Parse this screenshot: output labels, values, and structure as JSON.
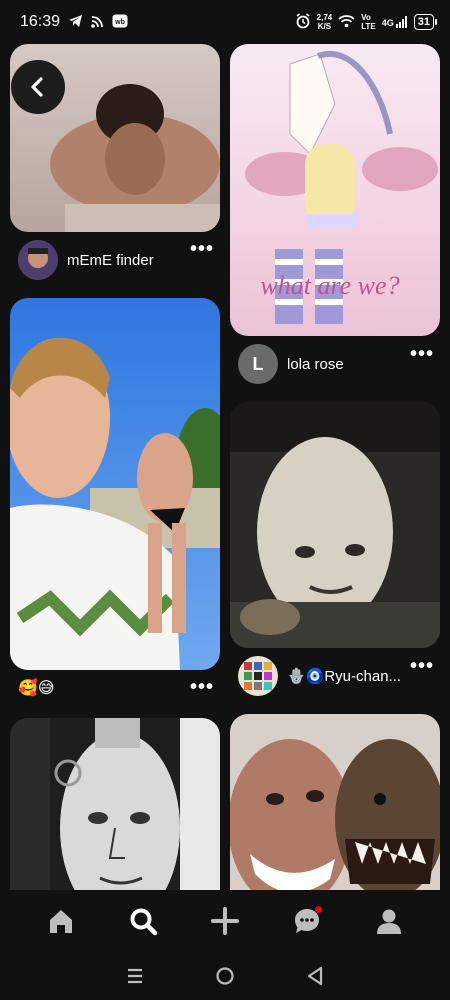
{
  "status_bar": {
    "time": "16:39",
    "net_speed_value": "2,74",
    "net_speed_unit": "K/S",
    "volte_top": "Vo",
    "volte_bottom": "LTE",
    "signal_label": "4G",
    "battery": "31",
    "icons": [
      "telegram-icon",
      "rss-icon",
      "wb-icon",
      "alarm-icon",
      "wifi-icon",
      "signal-icon",
      "battery-icon"
    ]
  },
  "feed": {
    "pins": [
      {
        "author": "mEmE finder",
        "caption": ""
      },
      {
        "author": "lola rose",
        "avatar_letter": "L",
        "image_text": "what are we?"
      },
      {
        "author": "",
        "caption": "🥰😅"
      },
      {
        "author": "🪬🧿Ryu-chan..."
      },
      {
        "author": ""
      },
      {
        "author": ""
      }
    ],
    "more_label": "•••"
  },
  "bottom_nav": {
    "items": [
      "home-icon",
      "search-icon",
      "create-icon",
      "messages-icon",
      "profile-icon"
    ],
    "active": "search",
    "notification_color": "#e60023"
  },
  "colors": {
    "background": "#111111",
    "accent": "#e60023"
  }
}
